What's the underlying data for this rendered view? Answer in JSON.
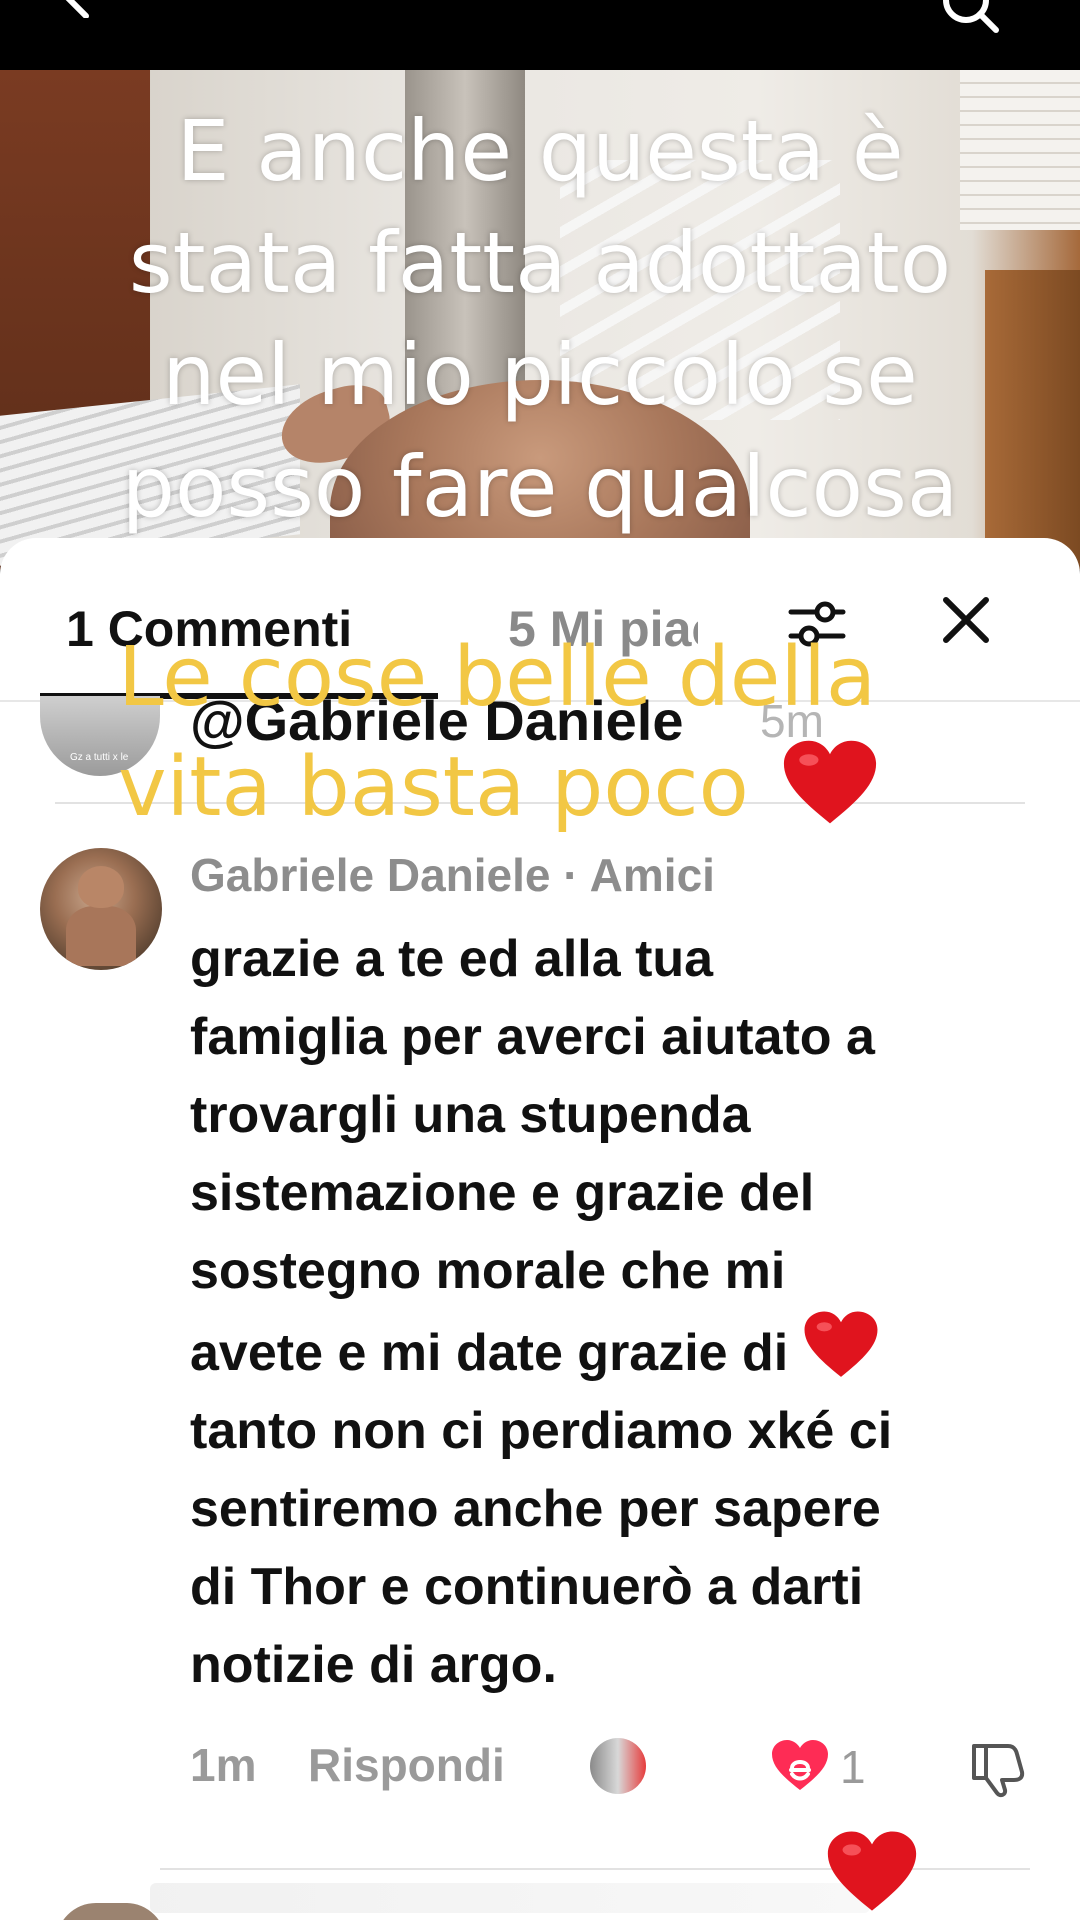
{
  "video": {
    "caption": "E anche questa è\nstata fatta adottato\nnel mio piccolo se\nposso fare qualcosa"
  },
  "sheet": {
    "tabs": {
      "comments": "1 Commenti",
      "likes": "5 Mi piac"
    },
    "sticker": {
      "text": "Le cose belle della\nvita basta poco",
      "color": "#f2c744"
    },
    "mention": {
      "handle": "@Gabriele Daniele",
      "time": "5m",
      "avatar_caption": "Gz a tutti x le"
    },
    "comment": {
      "author": "Gabriele Daniele",
      "relation": "· Amici",
      "text_before_heart": "grazie a te ed alla tua\nfamiglia per averci aiutato a\ntrovargli una stupenda\nsistemazione e grazie del\nsostegno morale che mi\navete e mi date grazie di ",
      "text_after_heart": "\ntanto non ci perdiamo xké ci\nsentiremo anche per sapere\ndi Thor e continuerò a darti\nnotizie di argo.",
      "time": "1m",
      "reply_label": "Rispondi",
      "like_count": "1"
    }
  },
  "colors": {
    "heart": "#e0141e",
    "like_icon": "#fe2c55",
    "text_primary": "#111111",
    "text_secondary": "#8d8d8d"
  }
}
